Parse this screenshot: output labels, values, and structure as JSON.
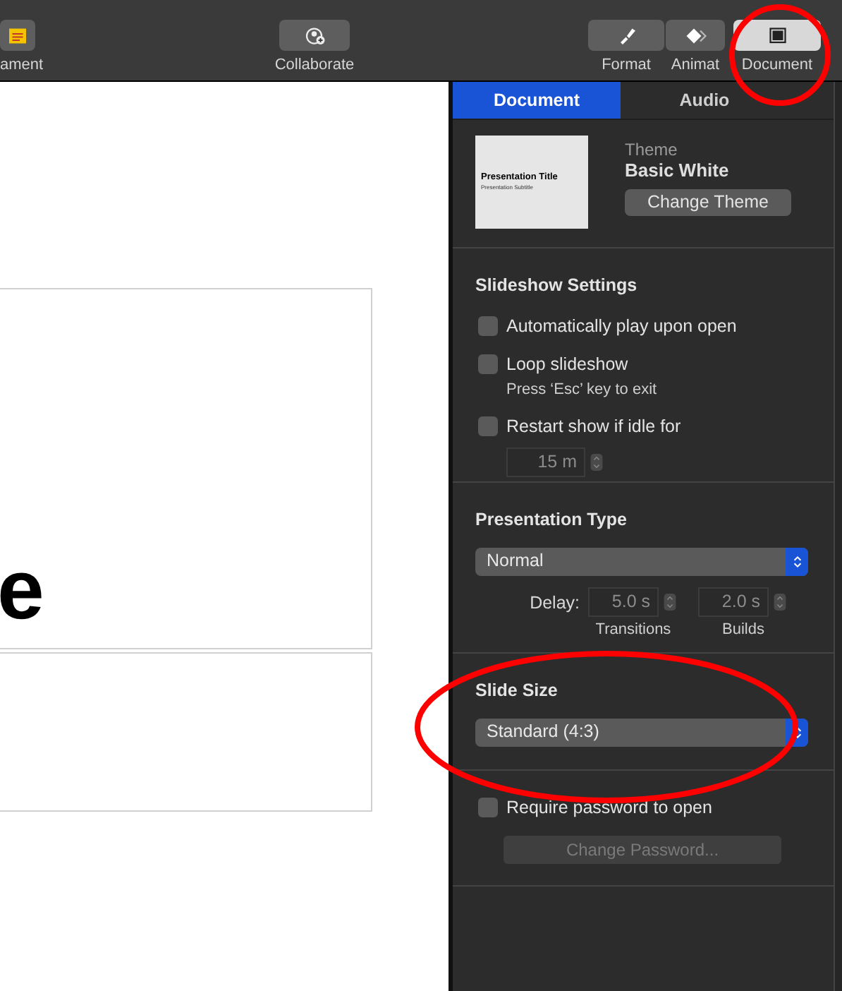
{
  "toolbar": {
    "items": [
      {
        "label": "ament",
        "kind": "comment",
        "selected": false
      },
      {
        "label": "Collaborate",
        "kind": "collaborate",
        "selected": false
      },
      {
        "label": "Format",
        "kind": "format",
        "selected": false
      },
      {
        "label": "Animat",
        "kind": "animate",
        "selected": false
      },
      {
        "label": "Document",
        "kind": "document",
        "selected": true
      }
    ]
  },
  "canvas": {
    "slide_text": "e"
  },
  "inspector": {
    "tabs": [
      {
        "label": "Document",
        "selected": true
      },
      {
        "label": "Audio",
        "selected": false
      }
    ],
    "theme": {
      "thumbnail_title": "Presentation Title",
      "thumbnail_subtitle": "Presentation Subtitle",
      "caption": "Theme",
      "name": "Basic White",
      "button": "Change Theme"
    },
    "slideshow_settings": {
      "heading": "Slideshow Settings",
      "options": [
        {
          "label": "Automatically play upon open",
          "checked": false
        },
        {
          "label": "Loop slideshow",
          "checked": false,
          "hint": "Press ‘Esc’ key to exit"
        },
        {
          "label": "Restart show if idle for",
          "checked": false,
          "stepper": "15 m"
        }
      ]
    },
    "presentation_type": {
      "heading": "Presentation Type",
      "value": "Normal",
      "delay_label": "Delay:",
      "delays": [
        {
          "value": "5.0 s",
          "caption": "Transitions"
        },
        {
          "value": "2.0 s",
          "caption": "Builds"
        }
      ]
    },
    "slide_size": {
      "heading": "Slide Size",
      "value": "Standard (4:3)"
    },
    "password": {
      "label": "Require password to open",
      "checked": false,
      "button": "Change Password...",
      "button_disabled": true
    }
  },
  "annotations": [
    {
      "kind": "circle"
    },
    {
      "kind": "ellipse"
    }
  ]
}
